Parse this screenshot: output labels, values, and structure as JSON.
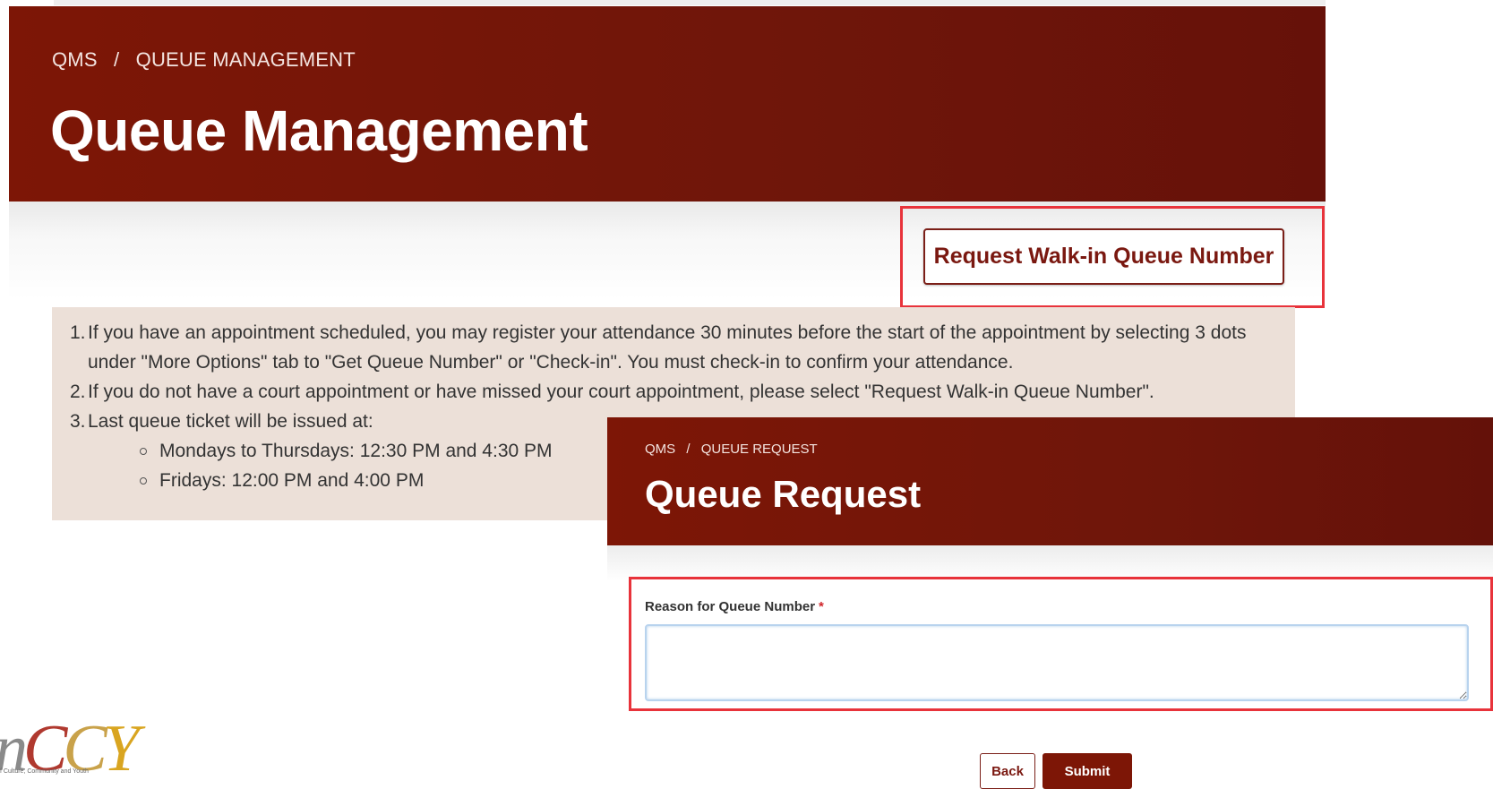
{
  "queue_management": {
    "breadcrumb": [
      "QMS",
      "QUEUE MANAGEMENT"
    ],
    "breadcrumb_sep": "/",
    "title": "Queue Management",
    "walkin_button": "Request Walk-in Queue Number",
    "instructions": {
      "item1_num": "1.",
      "item1": "If you have an appointment scheduled, you may register your attendance 30 minutes before the start of the appointment by selecting 3 dots under \"More Options\" tab to \"Get Queue Number\" or \"Check-in\". You must check-in to confirm your attendance.",
      "item2_num": "2.",
      "item2": "If you do not have a court appointment or have missed your court appointment, please select \"Request Walk-in Queue Number\".",
      "item3_num": "3.",
      "item3": "Last queue ticket will be issued at:",
      "sub1": "Mondays to Thursdays: 12:30 PM and 4:30 PM",
      "sub2": "Fridays: 12:00 PM and 4:00 PM"
    }
  },
  "queue_request": {
    "breadcrumb": [
      "QMS",
      "QUEUE REQUEST"
    ],
    "breadcrumb_sep": "/",
    "title": "Queue Request",
    "reason_label": "Reason for Queue Number",
    "required_mark": "*",
    "reason_value": "",
    "back_button": "Back",
    "submit_button": "Submit"
  },
  "logo": {
    "letters": "nCCY",
    "tagline": "f Culture, Community and Youth"
  },
  "colors": {
    "banner": "#7d1606",
    "accent_text": "#7a1810",
    "highlight": "#e8333b",
    "info_bg": "#ece0d8",
    "logo_c1": "#b0392f",
    "logo_c2": "#c9a24a"
  }
}
